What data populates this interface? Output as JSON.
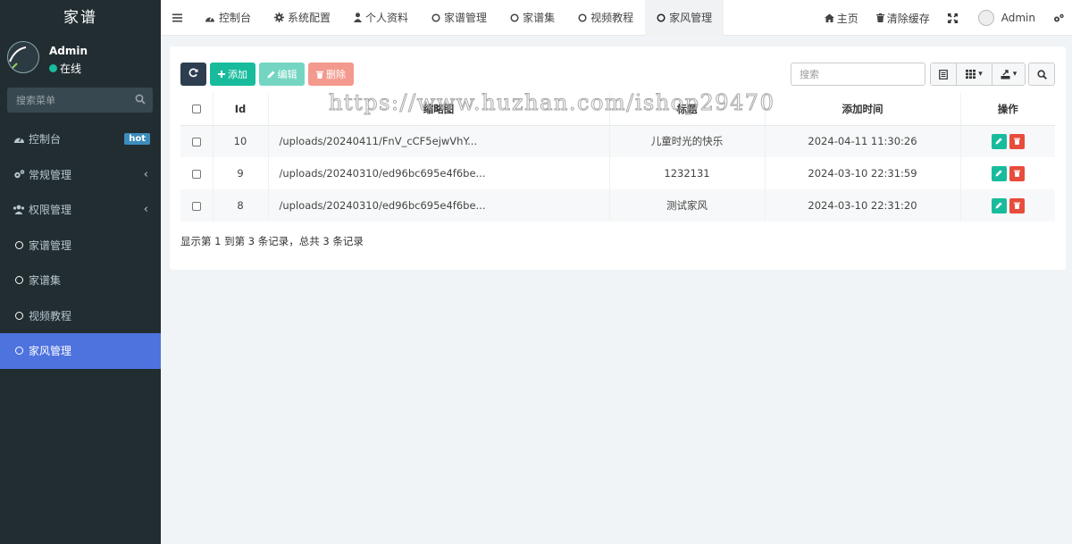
{
  "app": {
    "title": "家谱"
  },
  "user": {
    "name": "Admin",
    "status": "在线"
  },
  "sidebar": {
    "search_placeholder": "搜索菜单",
    "items": [
      {
        "label": "控制台",
        "badge": "hot"
      },
      {
        "label": "常规管理"
      },
      {
        "label": "权限管理"
      },
      {
        "label": "家谱管理"
      },
      {
        "label": "家谱集"
      },
      {
        "label": "视频教程"
      },
      {
        "label": "家风管理",
        "active": true
      }
    ]
  },
  "topbar": {
    "tabs": [
      {
        "label": "控制台",
        "icon": "dashboard-icon"
      },
      {
        "label": "系统配置",
        "icon": "gear-icon"
      },
      {
        "label": "个人资料",
        "icon": "user-icon"
      },
      {
        "label": "家谱管理",
        "icon": "circle-icon"
      },
      {
        "label": "家谱集",
        "icon": "circle-icon"
      },
      {
        "label": "视频教程",
        "icon": "circle-icon"
      },
      {
        "label": "家风管理",
        "icon": "circle-icon",
        "active": true
      }
    ],
    "home_label": "主页",
    "clear_cache_label": "清除缓存",
    "admin_label": "Admin"
  },
  "toolbar": {
    "add_label": "添加",
    "edit_label": "编辑",
    "delete_label": "删除",
    "search_placeholder": "搜索"
  },
  "table": {
    "headers": {
      "id": "Id",
      "image": "缩略图",
      "title": "标题",
      "time": "添加时间",
      "ops": "操作"
    },
    "rows": [
      {
        "id": "10",
        "image": "/uploads/20240411/FnV_cCF5ejwVhY...",
        "title": "儿童时光的快乐",
        "time": "2024-04-11 11:30:26"
      },
      {
        "id": "9",
        "image": "/uploads/20240310/ed96bc695e4f6be...",
        "title": "1232131",
        "time": "2024-03-10 22:31:59"
      },
      {
        "id": "8",
        "image": "/uploads/20240310/ed96bc695e4f6be...",
        "title": "测试家风",
        "time": "2024-03-10 22:31:20"
      }
    ]
  },
  "footer": {
    "summary": "显示第 1 到第 3 条记录，总共 3 条记录"
  },
  "watermark": {
    "text": "https://www.huzhan.com/ishop29470"
  },
  "colors": {
    "sidebar_bg": "#222d32",
    "active_menu": "#4e73df",
    "success": "#18bc9c",
    "danger": "#e74c3c",
    "dark": "#2c3e50"
  }
}
